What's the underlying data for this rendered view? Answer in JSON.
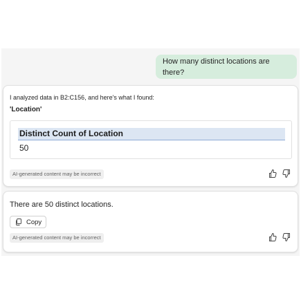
{
  "conversation": {
    "user_message": "How many distinct locations are there?",
    "response_1": {
      "intro": "I analyzed data in B2:C156, and here's what I found:",
      "field_label": "'Location'",
      "result_header": "Distinct Count of Location",
      "result_value": "50",
      "disclaimer": "AI-generated content may be incorrect",
      "icons": [
        "thumbs-up-icon",
        "thumbs-down-icon"
      ]
    },
    "response_2": {
      "text": "There are 50 distinct locations.",
      "copy_label": "Copy",
      "copy_icon": "copy-icon",
      "disclaimer": "AI-generated content may be incorrect",
      "icons": [
        "thumbs-up-icon",
        "thumbs-down-icon"
      ]
    }
  },
  "colors": {
    "user_bubble": "#d6eddd",
    "table_header": "#dce6f3",
    "pane_bg": "#f5f5f5"
  }
}
